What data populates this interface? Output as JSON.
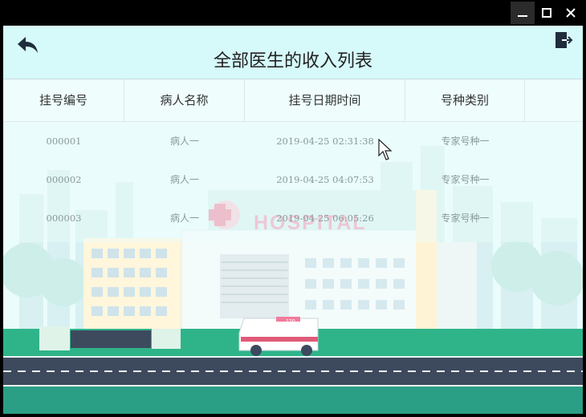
{
  "window": {
    "controls": [
      "minimize-icon",
      "maximize-icon",
      "close-icon"
    ]
  },
  "header": {
    "title": "全部医生的收入列表",
    "back_icon": "back-arrow-icon",
    "exit_icon": "exit-icon"
  },
  "table": {
    "columns": [
      "挂号编号",
      "病人名称",
      "挂号日期时间",
      "号种类别",
      ""
    ],
    "rows": [
      {
        "id": "000001",
        "patient": "病人一",
        "datetime": "2019-04-25 02:31:38",
        "type": "专家号种一"
      },
      {
        "id": "000002",
        "patient": "病人一",
        "datetime": "2019-04-25 04:07:53",
        "type": "专家号种一"
      },
      {
        "id": "000003",
        "patient": "病人一",
        "datetime": "2019-04-25 06:05:26",
        "type": "专家号种一"
      }
    ]
  },
  "background": {
    "sign_text": "HOSPITAL",
    "ambulance_label": "120",
    "colors": {
      "sky": "#eafcfb",
      "grass": "#2fb48a",
      "road": "#3d4a5e",
      "sign": "#f27b9b"
    }
  }
}
